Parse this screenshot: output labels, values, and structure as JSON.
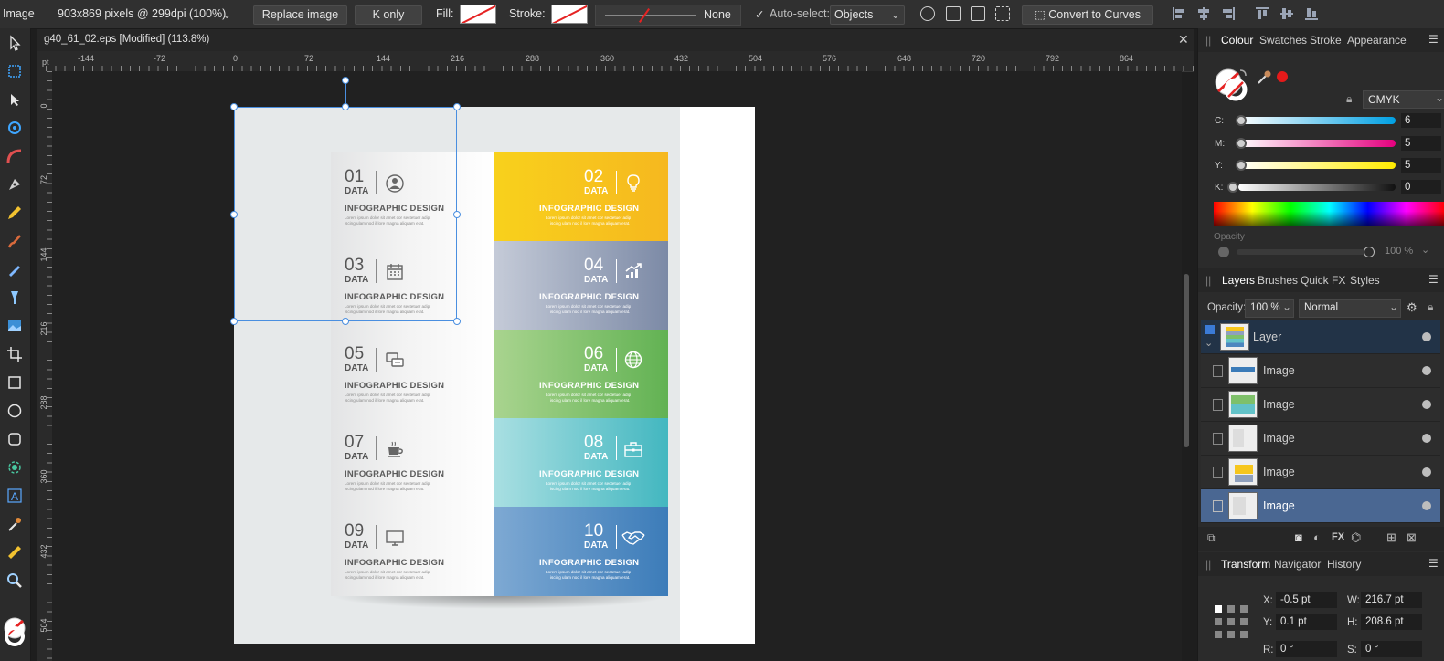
{
  "context_toolbar": {
    "tool_name": "Image",
    "image_info": "903x869 pixels @ 299dpi (100%)",
    "replace_image": "Replace image",
    "k_only": "K only",
    "fill_label": "Fill:",
    "stroke_label": "Stroke:",
    "stroke_value": "None",
    "autoselect_label": "Auto-select:",
    "autoselect_value": "Objects",
    "convert_to_curves": "Convert to Curves"
  },
  "document": {
    "tab_title": "g40_61_02.eps [Modified] (113.8%)",
    "ruler_unit": "pt",
    "ruler_top_ticks": [
      "-144",
      "-72",
      "0",
      "72",
      "144",
      "216",
      "288",
      "360",
      "432",
      "504",
      "576",
      "648",
      "720",
      "792",
      "864"
    ],
    "ruler_left_ticks": [
      "0",
      "72",
      "144",
      "216",
      "288",
      "360",
      "432",
      "504"
    ]
  },
  "infographic": {
    "data_label": "DATA",
    "title": "INFOGRAPHIC DESIGN",
    "body_line1": "Lorem ipsum dolor sit amet cor sectetuer adip",
    "body_line2": "iscing ulam nod il lore magna aliquam erat.",
    "rows": [
      {
        "left_num": "01",
        "right_num": "02",
        "right_color": "yellow"
      },
      {
        "left_num": "03",
        "right_num": "04",
        "right_color": "slate"
      },
      {
        "left_num": "05",
        "right_num": "06",
        "right_color": "green"
      },
      {
        "left_num": "07",
        "right_num": "08",
        "right_color": "teal"
      },
      {
        "left_num": "09",
        "right_num": "10",
        "right_color": "blue"
      }
    ]
  },
  "colour_panel": {
    "tabs": [
      "Colour",
      "Swatches",
      "Stroke",
      "Appearance"
    ],
    "model": "CMYK",
    "channels": [
      {
        "label": "C:",
        "value": "6"
      },
      {
        "label": "M:",
        "value": "5"
      },
      {
        "label": "Y:",
        "value": "5"
      },
      {
        "label": "K:",
        "value": "0"
      }
    ],
    "opacity_label": "Opacity",
    "opacity_value": "100 %"
  },
  "layers_panel": {
    "tabs": [
      "Layers",
      "Brushes",
      "Quick FX",
      "Styles"
    ],
    "opacity_label": "Opacity:",
    "opacity_value": "100 %",
    "blend_mode": "Normal",
    "layers": [
      {
        "name": "Layer"
      },
      {
        "name": "Image"
      },
      {
        "name": "Image"
      },
      {
        "name": "Image"
      },
      {
        "name": "Image"
      },
      {
        "name": "Image"
      }
    ]
  },
  "transform_panel": {
    "tabs": [
      "Transform",
      "Navigator",
      "History"
    ],
    "x_label": "X:",
    "x_value": "-0.5 pt",
    "y_label": "Y:",
    "y_value": "0.1 pt",
    "w_label": "W:",
    "w_value": "216.7 pt",
    "h_label": "H:",
    "h_value": "208.6 pt",
    "r_label": "R:",
    "r_value": "0 °",
    "s_label": "S:",
    "s_value": "0 °"
  }
}
